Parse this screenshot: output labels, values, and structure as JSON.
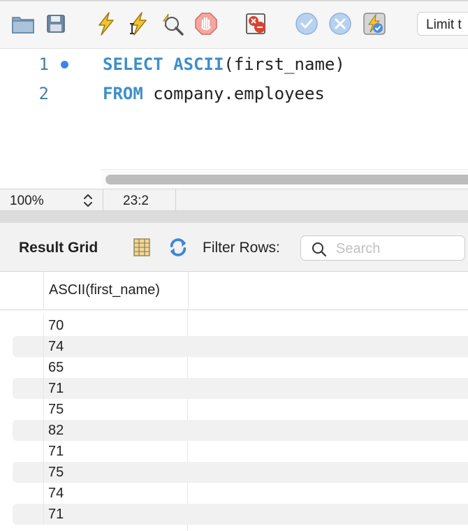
{
  "toolbar": {
    "limit_label": "Limit t",
    "icons": [
      "open-folder-icon",
      "save-icon",
      "execute-icon",
      "execute-current-icon",
      "explain-icon",
      "stop-icon",
      "toggle-error-icon",
      "commit-icon",
      "rollback-icon",
      "autocommit-icon"
    ]
  },
  "editor": {
    "lines": [
      {
        "number": "1",
        "keyword": "SELECT",
        "keyword2": "ASCII",
        "rest": "(first_name)"
      },
      {
        "number": "2",
        "keyword": "FROM",
        "rest": " company.employees"
      }
    ]
  },
  "status": {
    "zoom": "100%",
    "cursor_position": "23:2"
  },
  "result": {
    "title": "Result Grid",
    "filter_label": "Filter Rows:",
    "search_placeholder": "Search",
    "column": "ASCII(first_name)",
    "rows": [
      "70",
      "74",
      "65",
      "71",
      "75",
      "82",
      "71",
      "75",
      "74",
      "71"
    ]
  },
  "colors": {
    "keyword": "#3e8fc7",
    "line_number": "#4a7ea0",
    "breakpoint_dot": "#3a86e8"
  }
}
